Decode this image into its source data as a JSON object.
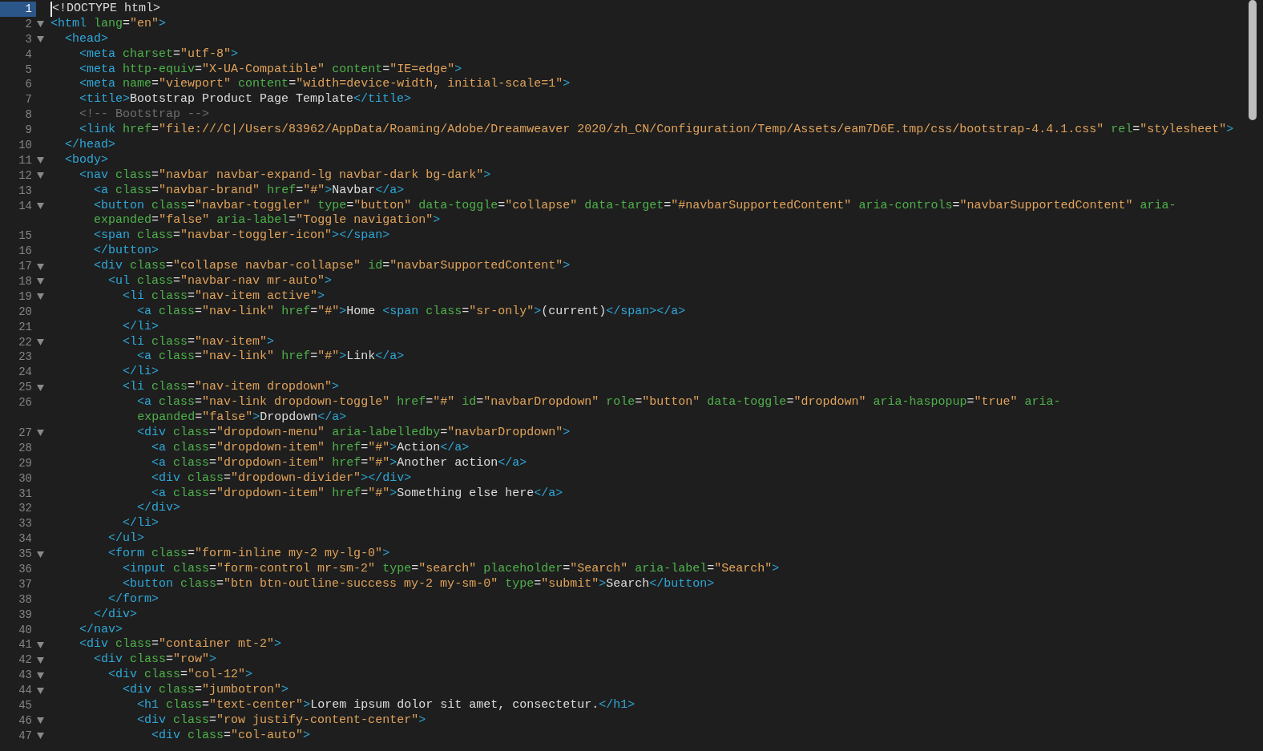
{
  "editor": {
    "lines": [
      {
        "number": "1",
        "foldable": false,
        "current": true,
        "rows": [
          "<!DOCTYPE html>"
        ]
      },
      {
        "number": "2",
        "foldable": true,
        "current": false,
        "rows": [
          "<html lang=\"en\">"
        ]
      },
      {
        "number": "3",
        "foldable": true,
        "current": false,
        "rows": [
          "  <head>"
        ]
      },
      {
        "number": "4",
        "foldable": false,
        "current": false,
        "rows": [
          "    <meta charset=\"utf-8\">"
        ]
      },
      {
        "number": "5",
        "foldable": false,
        "current": false,
        "rows": [
          "    <meta http-equiv=\"X-UA-Compatible\" content=\"IE=edge\">"
        ]
      },
      {
        "number": "6",
        "foldable": false,
        "current": false,
        "rows": [
          "    <meta name=\"viewport\" content=\"width=device-width, initial-scale=1\">"
        ]
      },
      {
        "number": "7",
        "foldable": false,
        "current": false,
        "rows": [
          "    <title>Bootstrap Product Page Template</title>"
        ]
      },
      {
        "number": "8",
        "foldable": false,
        "current": false,
        "rows": [
          "    <!-- Bootstrap -->"
        ]
      },
      {
        "number": "9",
        "foldable": false,
        "current": false,
        "rows": [
          "    <link href=\"file:///C|/Users/83962/AppData/Roaming/Adobe/Dreamweaver 2020/zh_CN/Configuration/Temp/Assets/eam7D6E.tmp/css/bootstrap-4.4.1.css\" rel=\"stylesheet\">"
        ]
      },
      {
        "number": "10",
        "foldable": false,
        "current": false,
        "rows": [
          "  </head>"
        ]
      },
      {
        "number": "11",
        "foldable": true,
        "current": false,
        "rows": [
          "  <body>"
        ]
      },
      {
        "number": "12",
        "foldable": true,
        "current": false,
        "rows": [
          "    <nav class=\"navbar navbar-expand-lg navbar-dark bg-dark\">"
        ]
      },
      {
        "number": "13",
        "foldable": false,
        "current": false,
        "rows": [
          "      <a class=\"navbar-brand\" href=\"#\">Navbar</a>"
        ]
      },
      {
        "number": "14",
        "foldable": true,
        "current": false,
        "rows": [
          "      <button class=\"navbar-toggler\" type=\"button\" data-toggle=\"collapse\" data-target=\"#navbarSupportedContent\" aria-controls=\"navbarSupportedContent\" aria-",
          "      expanded=\"false\" aria-label=\"Toggle navigation\">"
        ]
      },
      {
        "number": "15",
        "foldable": false,
        "current": false,
        "rows": [
          "      <span class=\"navbar-toggler-icon\"></span>"
        ]
      },
      {
        "number": "16",
        "foldable": false,
        "current": false,
        "rows": [
          "      </button>"
        ]
      },
      {
        "number": "17",
        "foldable": true,
        "current": false,
        "rows": [
          "      <div class=\"collapse navbar-collapse\" id=\"navbarSupportedContent\">"
        ]
      },
      {
        "number": "18",
        "foldable": true,
        "current": false,
        "rows": [
          "        <ul class=\"navbar-nav mr-auto\">"
        ]
      },
      {
        "number": "19",
        "foldable": true,
        "current": false,
        "rows": [
          "          <li class=\"nav-item active\">"
        ]
      },
      {
        "number": "20",
        "foldable": false,
        "current": false,
        "rows": [
          "            <a class=\"nav-link\" href=\"#\">Home <span class=\"sr-only\">(current)</span></a>"
        ]
      },
      {
        "number": "21",
        "foldable": false,
        "current": false,
        "rows": [
          "          </li>"
        ]
      },
      {
        "number": "22",
        "foldable": true,
        "current": false,
        "rows": [
          "          <li class=\"nav-item\">"
        ]
      },
      {
        "number": "23",
        "foldable": false,
        "current": false,
        "rows": [
          "            <a class=\"nav-link\" href=\"#\">Link</a>"
        ]
      },
      {
        "number": "24",
        "foldable": false,
        "current": false,
        "rows": [
          "          </li>"
        ]
      },
      {
        "number": "25",
        "foldable": true,
        "current": false,
        "rows": [
          "          <li class=\"nav-item dropdown\">"
        ]
      },
      {
        "number": "26",
        "foldable": false,
        "current": false,
        "rows": [
          "            <a class=\"nav-link dropdown-toggle\" href=\"#\" id=\"navbarDropdown\" role=\"button\" data-toggle=\"dropdown\" aria-haspopup=\"true\" aria-",
          "            expanded=\"false\">Dropdown</a>"
        ]
      },
      {
        "number": "27",
        "foldable": true,
        "current": false,
        "rows": [
          "            <div class=\"dropdown-menu\" aria-labelledby=\"navbarDropdown\">"
        ]
      },
      {
        "number": "28",
        "foldable": false,
        "current": false,
        "rows": [
          "              <a class=\"dropdown-item\" href=\"#\">Action</a>"
        ]
      },
      {
        "number": "29",
        "foldable": false,
        "current": false,
        "rows": [
          "              <a class=\"dropdown-item\" href=\"#\">Another action</a>"
        ]
      },
      {
        "number": "30",
        "foldable": false,
        "current": false,
        "rows": [
          "              <div class=\"dropdown-divider\"></div>"
        ]
      },
      {
        "number": "31",
        "foldable": false,
        "current": false,
        "rows": [
          "              <a class=\"dropdown-item\" href=\"#\">Something else here</a>"
        ]
      },
      {
        "number": "32",
        "foldable": false,
        "current": false,
        "rows": [
          "            </div>"
        ]
      },
      {
        "number": "33",
        "foldable": false,
        "current": false,
        "rows": [
          "          </li>"
        ]
      },
      {
        "number": "34",
        "foldable": false,
        "current": false,
        "rows": [
          "        </ul>"
        ]
      },
      {
        "number": "35",
        "foldable": true,
        "current": false,
        "rows": [
          "        <form class=\"form-inline my-2 my-lg-0\">"
        ]
      },
      {
        "number": "36",
        "foldable": false,
        "current": false,
        "rows": [
          "          <input class=\"form-control mr-sm-2\" type=\"search\" placeholder=\"Search\" aria-label=\"Search\">"
        ]
      },
      {
        "number": "37",
        "foldable": false,
        "current": false,
        "rows": [
          "          <button class=\"btn btn-outline-success my-2 my-sm-0\" type=\"submit\">Search</button>"
        ]
      },
      {
        "number": "38",
        "foldable": false,
        "current": false,
        "rows": [
          "        </form>"
        ]
      },
      {
        "number": "39",
        "foldable": false,
        "current": false,
        "rows": [
          "      </div>"
        ]
      },
      {
        "number": "40",
        "foldable": false,
        "current": false,
        "rows": [
          "    </nav>"
        ]
      },
      {
        "number": "41",
        "foldable": true,
        "current": false,
        "rows": [
          "    <div class=\"container mt-2\">"
        ]
      },
      {
        "number": "42",
        "foldable": true,
        "current": false,
        "rows": [
          "      <div class=\"row\">"
        ]
      },
      {
        "number": "43",
        "foldable": true,
        "current": false,
        "rows": [
          "        <div class=\"col-12\">"
        ]
      },
      {
        "number": "44",
        "foldable": true,
        "current": false,
        "rows": [
          "          <div class=\"jumbotron\">"
        ]
      },
      {
        "number": "45",
        "foldable": false,
        "current": false,
        "rows": [
          "            <h1 class=\"text-center\">Lorem ipsum dolor sit amet, consectetur.</h1>"
        ]
      },
      {
        "number": "46",
        "foldable": true,
        "current": false,
        "rows": [
          "            <div class=\"row justify-content-center\">"
        ]
      },
      {
        "number": "47",
        "foldable": true,
        "current": false,
        "rows": [
          "              <div class=\"col-auto\">"
        ]
      }
    ]
  }
}
